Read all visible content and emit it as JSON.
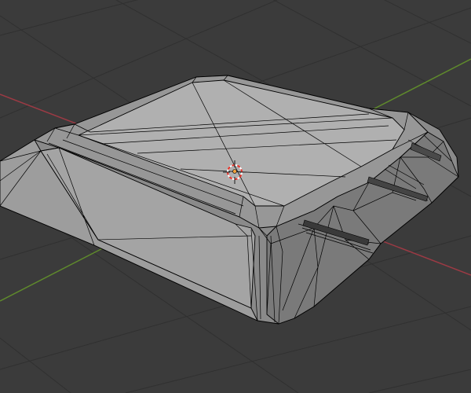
{
  "editor": {
    "type": "3D Viewport",
    "shading": "solid",
    "overlays": {
      "wireframe": true,
      "grid_floor": true,
      "axes": [
        "x-axis-red",
        "y-axis-green"
      ]
    }
  },
  "colors": {
    "background": "#3b3b3b",
    "grid": "#303030",
    "x_axis": "#9c3a44",
    "y_axis": "#5f8a2c",
    "mesh_top": "#a9a9a9",
    "mesh_side_light": "#9b9b9b",
    "mesh_side_dark": "#7d7d7d",
    "wire": "#000000",
    "cursor_red": "#e8342a",
    "cursor_white": "#ffffff",
    "origin_dot": "#f2a23a"
  },
  "scene": {
    "object": "mesh-bevelled-box",
    "icons": [
      "3d-cursor-icon",
      "object-origin-icon"
    ]
  }
}
